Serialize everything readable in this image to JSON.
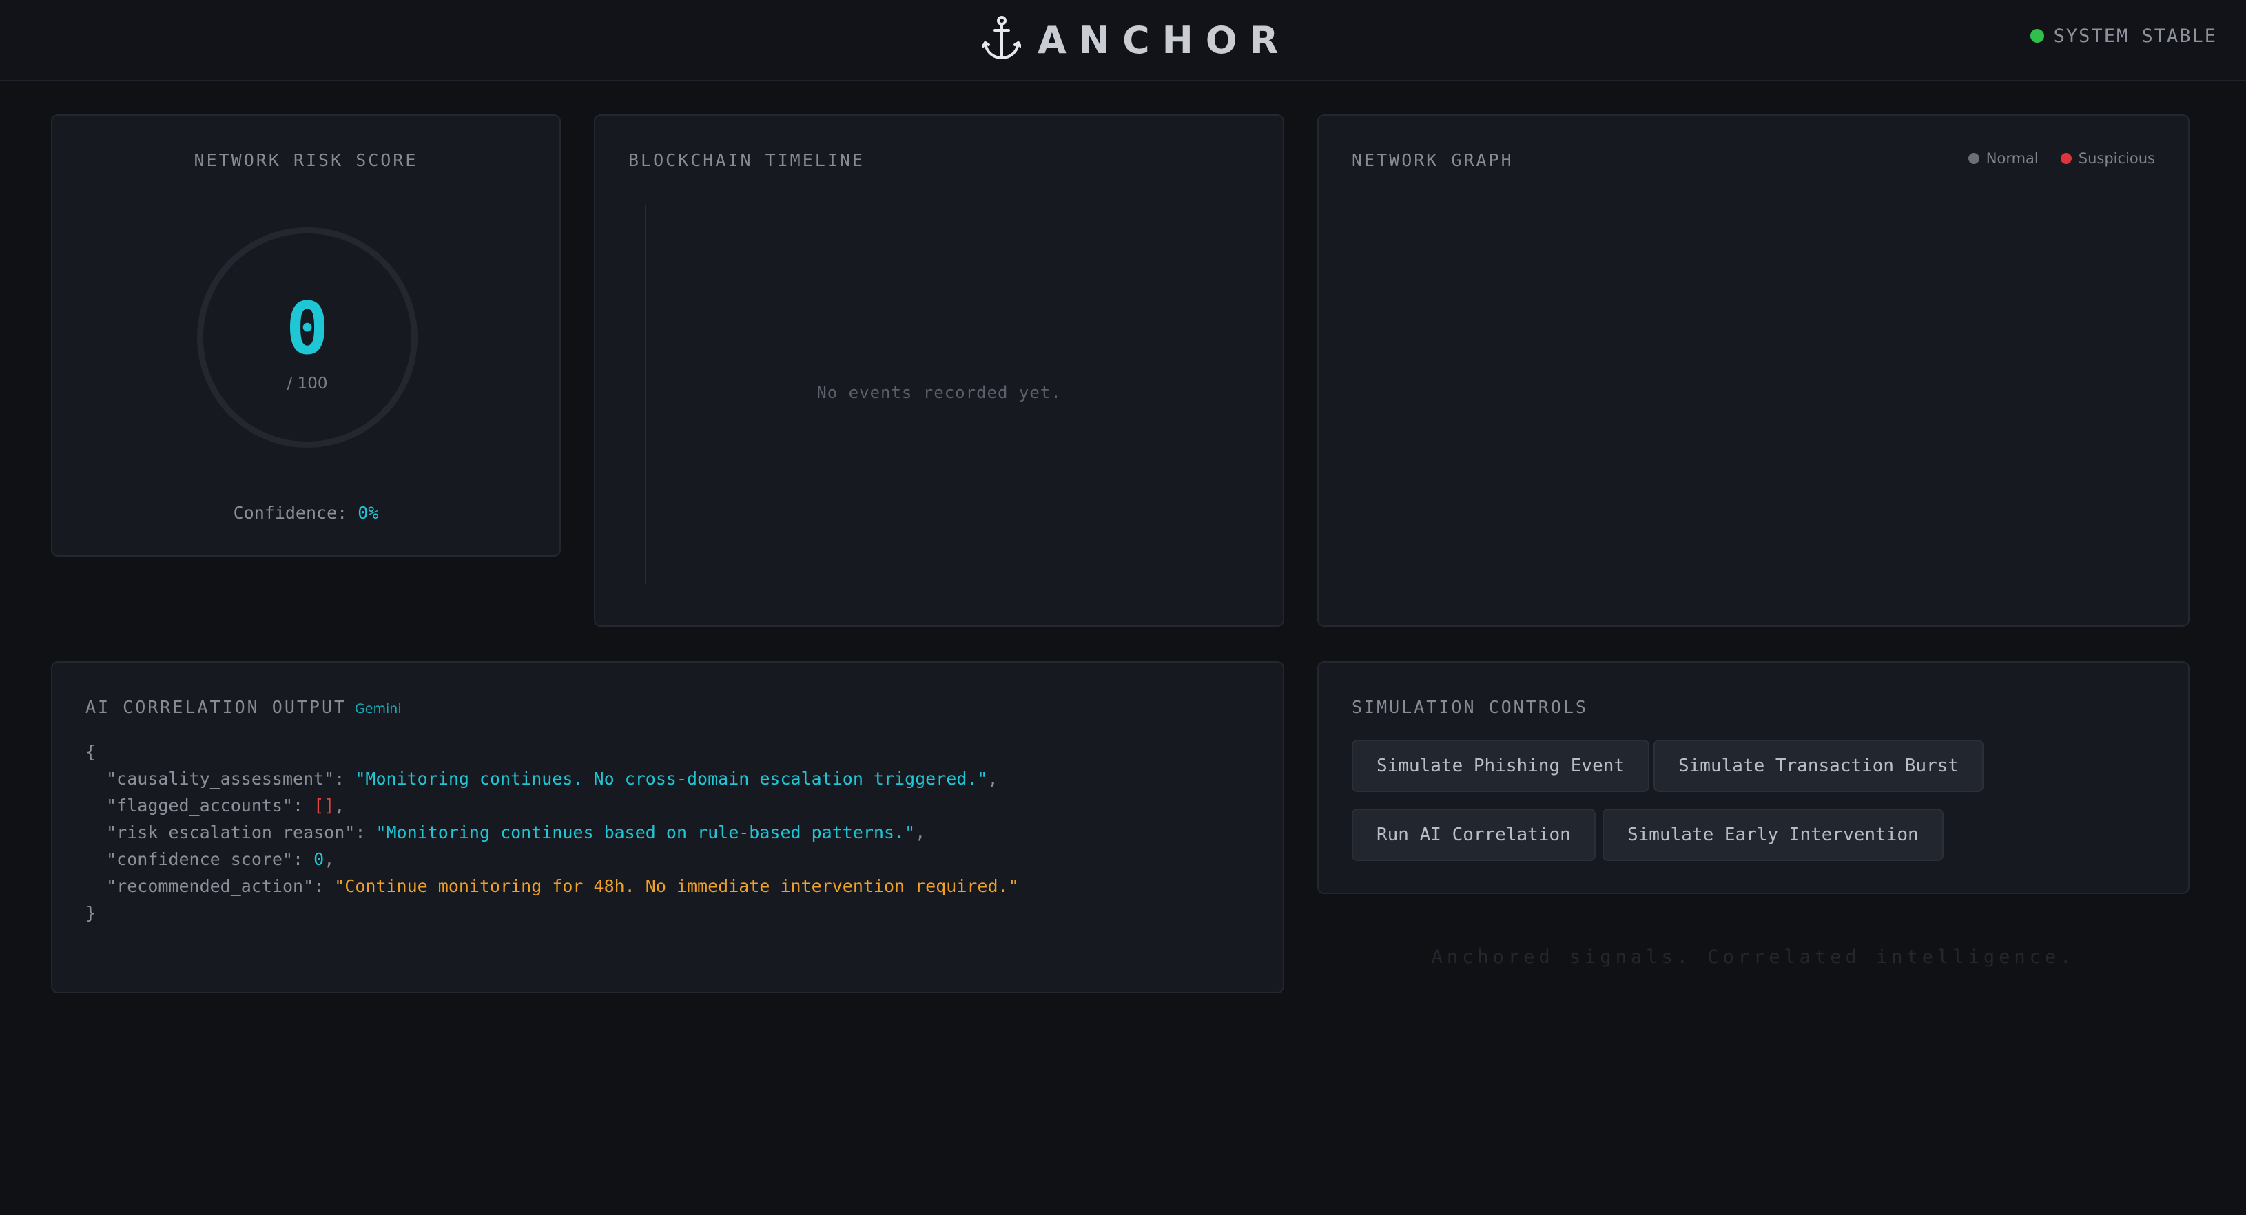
{
  "header": {
    "brand": "ANCHOR",
    "logo_icon": "anchor-icon",
    "status_label": "SYSTEM STABLE",
    "status_color": "#2fbf4a"
  },
  "risk_panel": {
    "title": "NETWORK RISK SCORE",
    "score": "0",
    "max": "/ 100",
    "confidence_label": "Confidence:",
    "confidence_value": "0%"
  },
  "timeline_panel": {
    "title": "BLOCKCHAIN TIMELINE",
    "empty_text": "No events recorded yet."
  },
  "graph_panel": {
    "title": "NETWORK GRAPH",
    "legend": [
      {
        "label": "Normal",
        "color": "#6b7078"
      },
      {
        "label": "Suspicious",
        "color": "#e0343c"
      }
    ]
  },
  "ai_panel": {
    "title": "AI CORRELATION OUTPUT",
    "model_tag": "Gemini",
    "output": {
      "open": "{",
      "close": "}",
      "causality_key": "\"causality_assessment\"",
      "causality_value": "\"Monitoring continues. No cross-domain escalation triggered.\"",
      "flagged_key": "\"flagged_accounts\"",
      "flagged_value": "[]",
      "reason_key": "\"risk_escalation_reason\"",
      "reason_value": "\"Monitoring continues based on rule-based patterns.\"",
      "confidence_key": "\"confidence_score\"",
      "confidence_value": "0",
      "action_key": "\"recommended_action\"",
      "action_value": "\"Continue monitoring for 48h. No immediate intervention required.\""
    }
  },
  "sim_panel": {
    "title": "SIMULATION CONTROLS",
    "buttons": [
      "Simulate Phishing Event",
      "Simulate Transaction Burst",
      "Run AI Correlation",
      "Simulate Early Intervention"
    ]
  },
  "footer": {
    "tagline": "Anchored signals. Correlated intelligence."
  }
}
